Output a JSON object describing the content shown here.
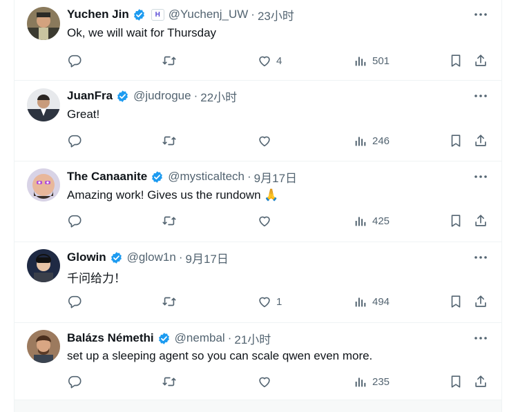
{
  "tweets": [
    {
      "name": "Yuchen Jin",
      "handle": "@Yuchenj_UW",
      "sep": "·",
      "time": "23小时",
      "text": "Ok, we will wait for Thursday",
      "affiliate_badge": "H",
      "likes": "4",
      "views": "501"
    },
    {
      "name": "JuanFra",
      "handle": "@judrogue",
      "sep": "·",
      "time": "22小时",
      "text": "Great!",
      "likes": "",
      "views": "246"
    },
    {
      "name": "The Canaanite",
      "handle": "@mysticaltech",
      "sep": "·",
      "time": "9月17日",
      "text": "Amazing work! Gives us the rundown 🙏",
      "likes": "",
      "views": "425"
    },
    {
      "name": "Glowin",
      "handle": "@glow1n",
      "sep": "·",
      "time": "9月17日",
      "text": "千问给力！",
      "likes": "1",
      "views": "494"
    },
    {
      "name": "Balázs Némethi",
      "handle": "@nembal",
      "sep": "·",
      "time": "21小时",
      "text": "set up a sleeping agent so you can scale qwen even more.",
      "likes": "",
      "views": "235"
    }
  ],
  "colors": {
    "verified": "#1d9bf0",
    "icon": "#536471",
    "text": "#0f1419",
    "divider": "#eff3f4"
  },
  "icons": [
    "reply-icon",
    "retweet-icon",
    "like-icon",
    "views-icon",
    "bookmark-icon",
    "share-icon",
    "more-icon",
    "verified-icon"
  ]
}
